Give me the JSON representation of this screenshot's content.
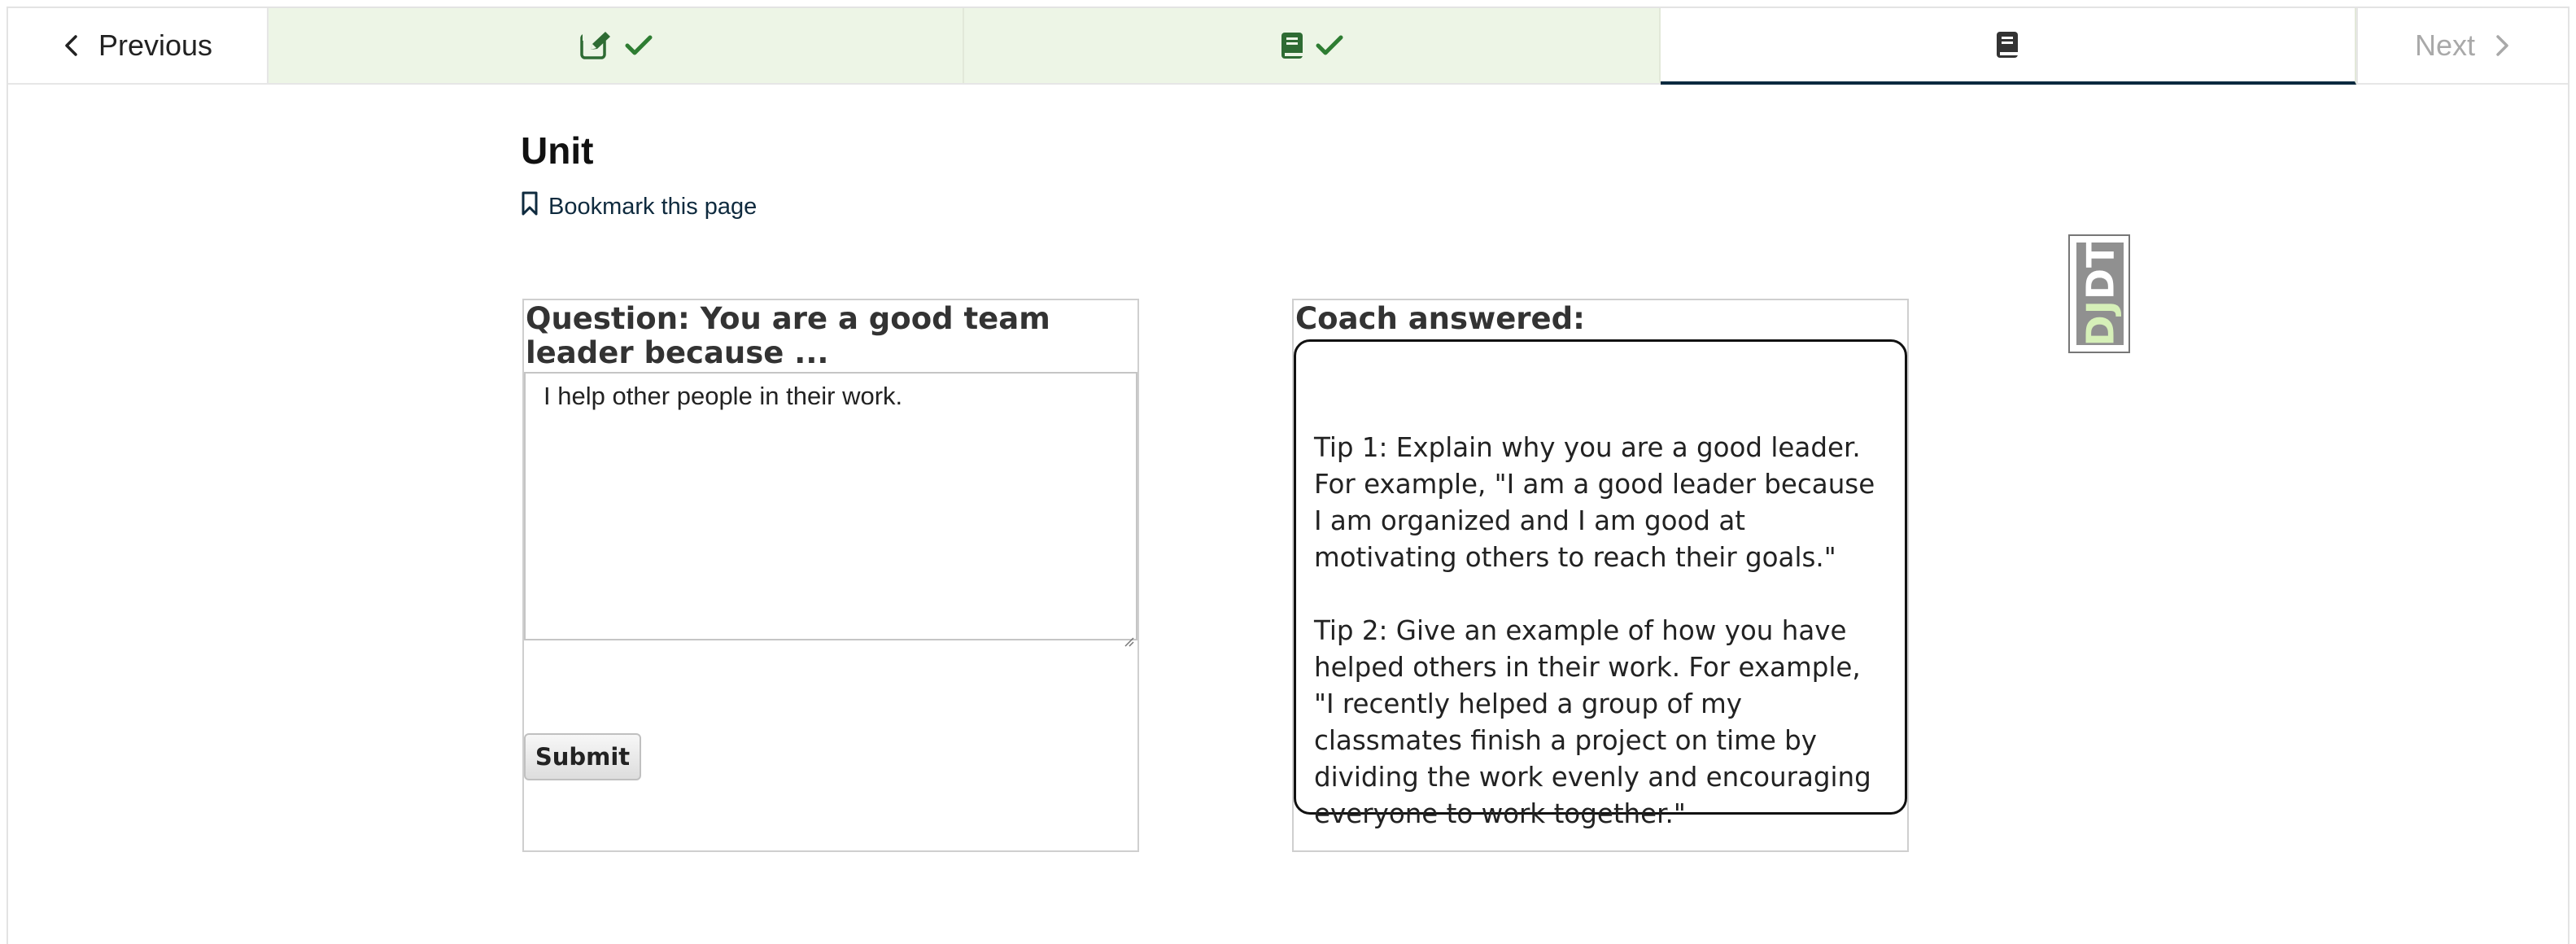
{
  "nav": {
    "previous_label": "Previous",
    "next_label": "Next",
    "tabs": [
      {
        "icon": "edit-icon",
        "status": "complete"
      },
      {
        "icon": "book-icon",
        "status": "complete"
      },
      {
        "icon": "book-icon",
        "status": "active"
      }
    ]
  },
  "page": {
    "title": "Unit",
    "bookmark_label": "Bookmark this page"
  },
  "question": {
    "title": "Question: You are a good team leader because ...",
    "answer_value": "I help other people in their work.",
    "submit_label": "Submit"
  },
  "coach": {
    "title": "Coach answered:",
    "tip1": "Tip 1: Explain why you are a good leader. For example, \"I am a good leader because I am organized and I am good at motivating others to reach their goals.\"",
    "tip2": "Tip 2: Give an example of how you have helped others in their work. For example, \"I recently helped a group of my classmates finish a project on time by dividing the work evenly and encouraging everyone to work together.\""
  },
  "debug_toolbar": {
    "label_dj": "DJ",
    "label_dt": "DT"
  },
  "colors": {
    "completed_tab_bg": "#edf5e6",
    "check_green": "#2e7d32",
    "active_underline": "#0b2a3f"
  }
}
